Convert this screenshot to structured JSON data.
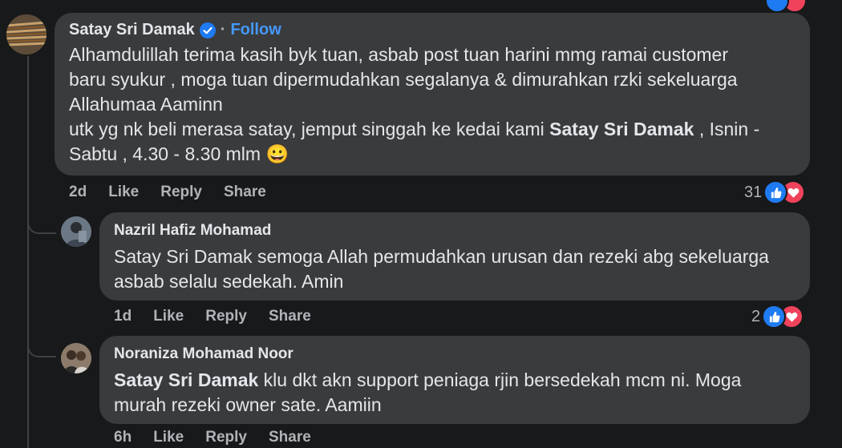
{
  "comments": [
    {
      "author": "Satay Sri Damak",
      "verified": true,
      "follow_label": "Follow",
      "separator": "·",
      "lines": [
        "Alhamdulillah terima kasih byk tuan, asbab post tuan harini mmg ramai customer",
        "baru syukur , moga tuan dipermudahkan segalanya & dimurahkan rzki sekeluarga",
        "Allahumaa Aaminn"
      ],
      "line4_prefix": "utk yg nk beli merasa satay, jemput singgah ke kedai kami ",
      "line4_bold": "Satay Sri Damak",
      "line4_suffix": " , Isnin -",
      "line5": "Sabtu , 4.30 - 8.30 mlm",
      "emoji": "😀",
      "time": "2d",
      "like": "Like",
      "reply": "Reply",
      "share": "Share",
      "reaction_count": "31"
    },
    {
      "author": "Nazril Hafiz Mohamad",
      "lines": [
        "Satay Sri Damak semoga Allah permudahkan urusan dan rezeki abg sekeluarga",
        "asbab selalu sedekah. Amin"
      ],
      "time": "1d",
      "like": "Like",
      "reply": "Reply",
      "share": "Share",
      "reaction_count": "2"
    },
    {
      "author": "Noraniza Mohamad Noor",
      "mention": "Satay Sri Damak",
      "line1_suffix": " klu dkt akn support peniaga rjin bersedekah mcm ni. Moga",
      "line2": "murah rezeki owner sate. Aamiin",
      "time": "6h",
      "like": "Like",
      "reply": "Reply",
      "share": "Share"
    }
  ],
  "colors": {
    "background": "#18191a",
    "bubble": "#3a3b3c",
    "link": "#4599ff",
    "like": "#1f7bf2",
    "love": "#f0435b"
  }
}
